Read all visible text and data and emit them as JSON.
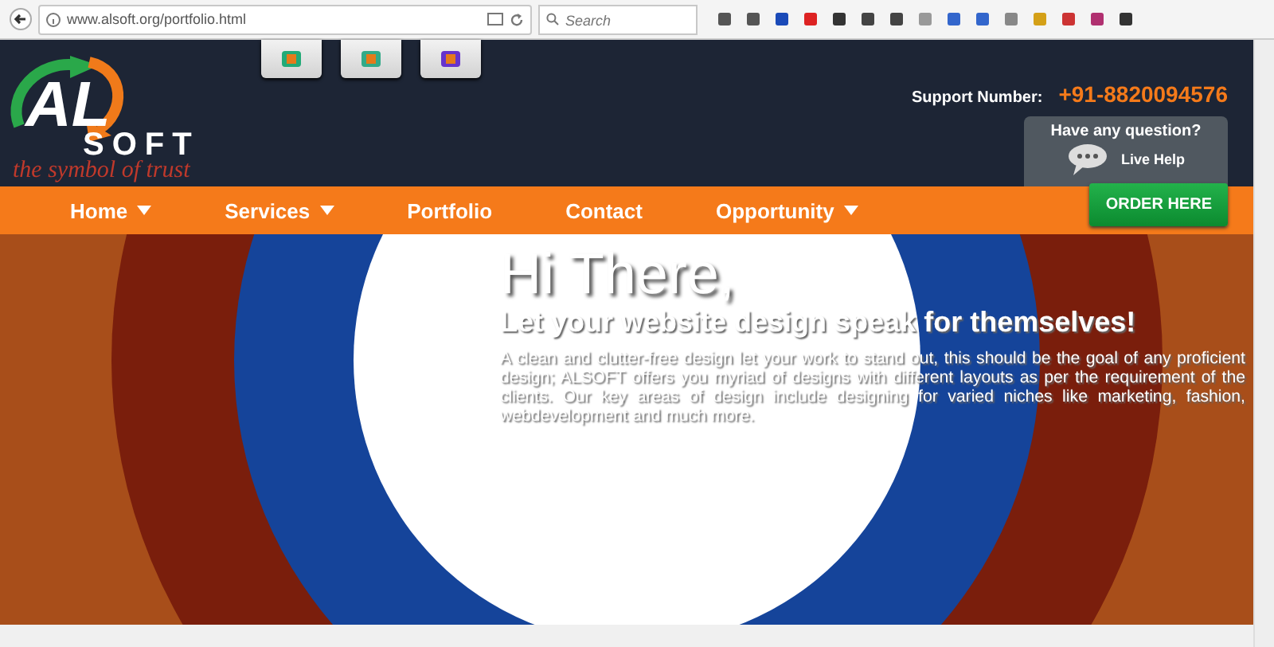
{
  "browser": {
    "url": "www.alsoft.org/portfolio.html",
    "search": {
      "placeholder": "Search"
    }
  },
  "header": {
    "logo": {
      "letters": "AL",
      "word": "SOFT",
      "tagline": "the symbol of trust"
    },
    "support_label": "Support Number:",
    "support_number": "+91-8820094576",
    "help": {
      "question": "Have any question?",
      "label": "Live Help"
    }
  },
  "nav": {
    "items": [
      {
        "label": "Home",
        "dropdown": true
      },
      {
        "label": "Services",
        "dropdown": true
      },
      {
        "label": "Portfolio",
        "dropdown": false
      },
      {
        "label": "Contact",
        "dropdown": false
      },
      {
        "label": "Opportunity",
        "dropdown": true
      }
    ],
    "order_button": "ORDER HERE"
  },
  "hero": {
    "title": "Hi There,",
    "subtitle": "Let your website design speak for themselves!",
    "body": "A clean and clutter-free design let your work to stand out, this should be the goal of any proficient design; ALSOFT offers you myriad of designs with different layouts as per the requirement of the clients. Our key areas of design include designing for varied niches like marketing, fashion, webdevelopment and much more."
  }
}
